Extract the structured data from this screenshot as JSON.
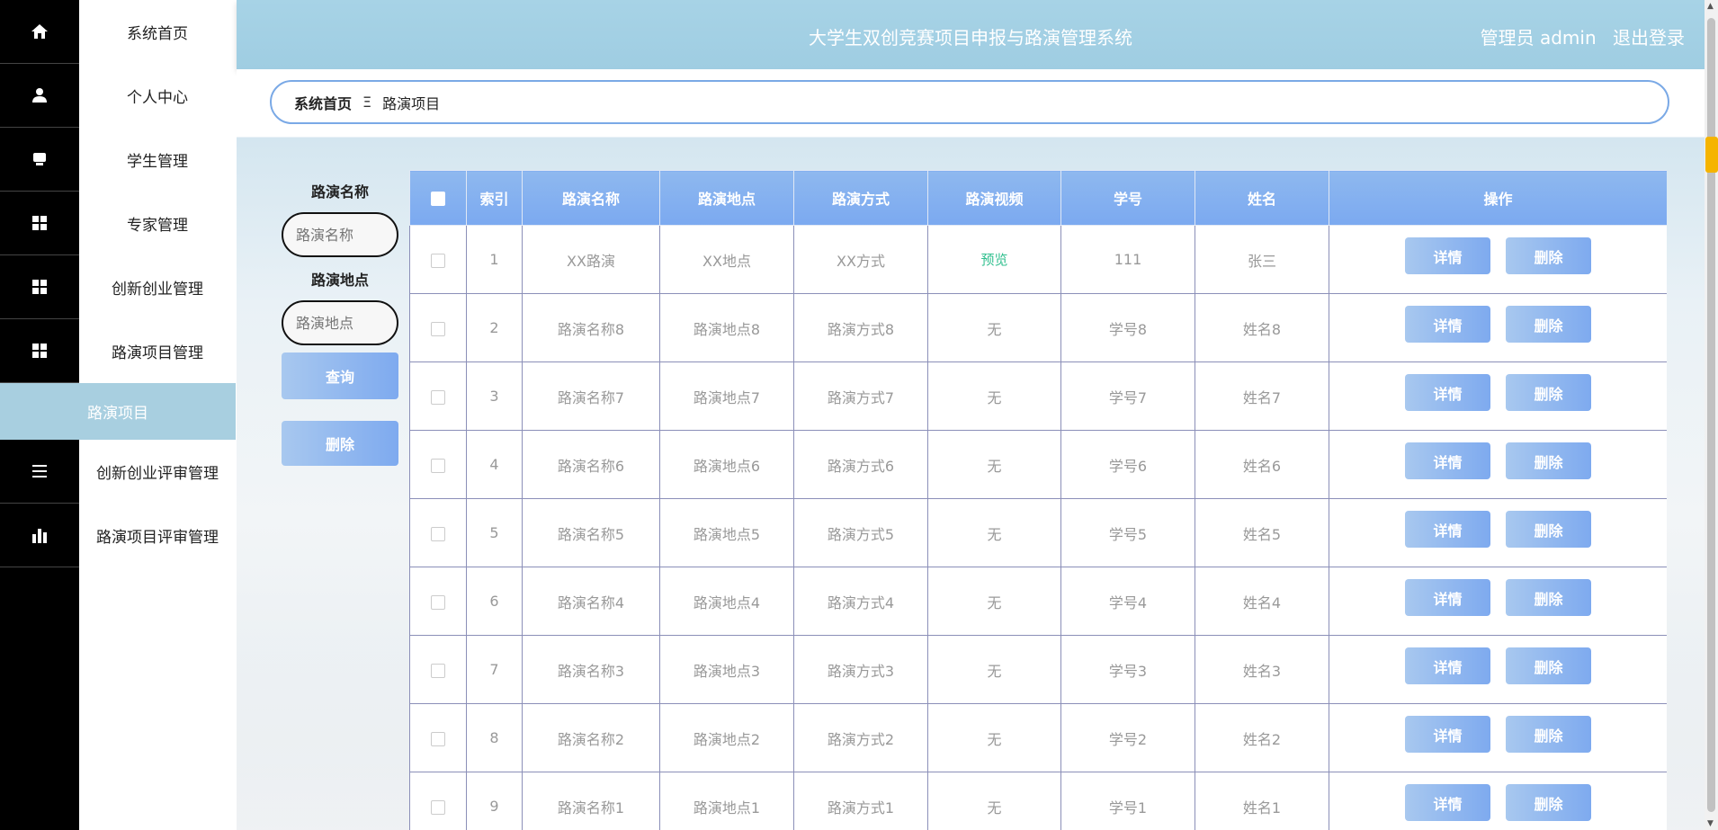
{
  "header": {
    "title": "大学生双创竞赛项目申报与路演管理系统",
    "user": "管理员 admin",
    "logout": "退出登录"
  },
  "sidebar": {
    "items": [
      {
        "label": "系统首页",
        "icon": "home-icon"
      },
      {
        "label": "个人中心",
        "icon": "user-icon"
      },
      {
        "label": "学生管理",
        "icon": "monitor-icon"
      },
      {
        "label": "专家管理",
        "icon": "grid-icon"
      },
      {
        "label": "创新创业管理",
        "icon": "grid-icon"
      },
      {
        "label": "路演项目管理",
        "icon": "grid-icon"
      }
    ],
    "sub_active": "路演项目",
    "items_after": [
      {
        "label": "创新创业评审管理",
        "icon": "list-icon"
      },
      {
        "label": "路演项目评审管理",
        "icon": "bar-chart-icon"
      }
    ]
  },
  "breadcrumb": {
    "home": "系统首页",
    "sep": "Ξ",
    "current": "路演项目"
  },
  "search": {
    "name_label": "路演名称",
    "name_placeholder": "路演名称",
    "place_label": "路演地点",
    "place_placeholder": "路演地点",
    "query_btn": "查询",
    "delete_btn": "删除"
  },
  "table": {
    "headers": [
      "索引",
      "路演名称",
      "路演地点",
      "路演方式",
      "路演视频",
      "学号",
      "姓名",
      "操作"
    ],
    "detail_btn": "详情",
    "delete_btn": "删除",
    "rows": [
      [
        "1",
        "XX路演",
        "XX地点",
        "XX方式",
        "预览",
        "111",
        "张三"
      ],
      [
        "2",
        "路演名称8",
        "路演地点8",
        "路演方式8",
        "无",
        "学号8",
        "姓名8"
      ],
      [
        "3",
        "路演名称7",
        "路演地点7",
        "路演方式7",
        "无",
        "学号7",
        "姓名7"
      ],
      [
        "4",
        "路演名称6",
        "路演地点6",
        "路演方式6",
        "无",
        "学号6",
        "姓名6"
      ],
      [
        "5",
        "路演名称5",
        "路演地点5",
        "路演方式5",
        "无",
        "学号5",
        "姓名5"
      ],
      [
        "6",
        "路演名称4",
        "路演地点4",
        "路演方式4",
        "无",
        "学号4",
        "姓名4"
      ],
      [
        "7",
        "路演名称3",
        "路演地点3",
        "路演方式3",
        "无",
        "学号3",
        "姓名3"
      ],
      [
        "8",
        "路演名称2",
        "路演地点2",
        "路演方式2",
        "无",
        "学号2",
        "姓名2"
      ],
      [
        "9",
        "路演名称1",
        "路演地点1",
        "路演方式1",
        "无",
        "学号1",
        "姓名1"
      ]
    ]
  },
  "colors": {
    "accent": "#7eaaef",
    "header": "#a7d3e6",
    "active_menu": "#a8cfe0",
    "preview": "#2fbf8e"
  }
}
